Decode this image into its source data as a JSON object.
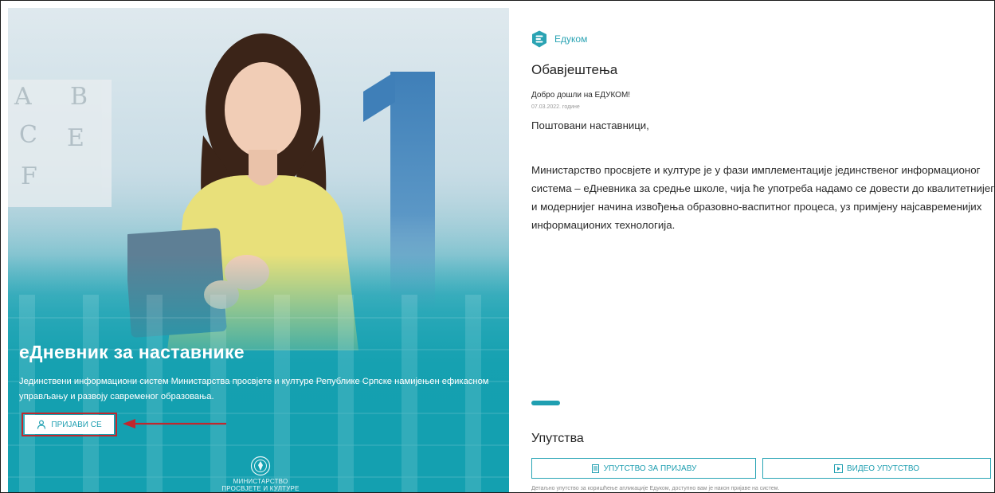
{
  "hero": {
    "title": "еДневник за наставнике",
    "description": "Јединствени информациони систем Министарства просвјете и културе Републике Српске намијењен ефикасном управљању и развоју савременог образовања.",
    "login_label": "ПРИЈАВИ СЕ",
    "board_letters": [
      "A",
      "B",
      "C",
      "E",
      "F"
    ],
    "ministry_line1": "МИНИСТАРСТВО",
    "ministry_line2": "ПРОСВЈЕТЕ И КУЛТУРЕ"
  },
  "brand": {
    "name": "Едуком",
    "logo_icon": "edukom-logo-icon"
  },
  "notices": {
    "heading": "Обавјештења",
    "item": {
      "title": "Добро дошли на ЕДУКОМ!",
      "date": "07.03.2022. године",
      "greeting": "Поштовани наставници,",
      "body": "Министарство просвјете и културе је у фази имплементације јединственог информационог система – еДневника за средње школе, чија ће употреба надамо се довести до квалитетнијег и модернијег начина извођења образовно-васпитног процеса, уз примјену најсавременијих информационих технологија."
    }
  },
  "guides": {
    "heading": "Упутства",
    "login_guide_label": "УПУТСТВО ЗА ПРИЈАВУ",
    "video_guide_label": "ВИДЕО УПУТСТВО",
    "note": "Детаљно упутство за коришћење апликације Едуком, доступно вам је након пријаве на систем."
  },
  "colors": {
    "accent": "#1f9fb1",
    "highlight": "#c0272d",
    "hero_teal": "#14a0b0"
  }
}
